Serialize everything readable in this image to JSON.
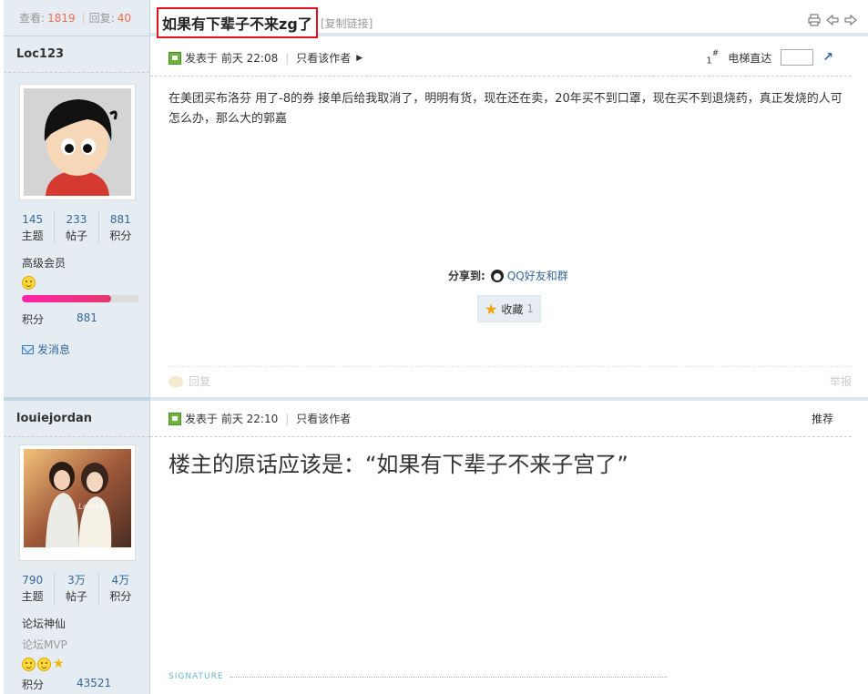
{
  "thread": {
    "views_label": "查看:",
    "views": "1819",
    "replies_label": "回复:",
    "replies": "40",
    "title": "如果有下辈子不来zg了",
    "copy_link": "[复制链接]"
  },
  "posts": [
    {
      "author": "Loc123",
      "stats": [
        {
          "value": "145",
          "label": "主题"
        },
        {
          "value": "233",
          "label": "帖子"
        },
        {
          "value": "881",
          "label": "积分"
        }
      ],
      "rank": "高级会员",
      "level_progress": 0.76,
      "score_label": "积分",
      "score": "881",
      "send_msg": "发消息",
      "posted": "发表于 前天 22:08",
      "only_author": "只看该作者",
      "floor": "1",
      "floor_mark": "#",
      "jump_label": "电梯直达",
      "content": "在美团买布洛芬 用了-8的券 接单后给我取消了，明明有货，现在还在卖，20年买不到口罩，现在买不到退烧药，真正发烧的人可怎么办，那么大的郭嘉",
      "share_label": "分享到:",
      "share_qq": "QQ好友和群",
      "fav_label": "收藏",
      "fav_count": "1",
      "reply": "回复",
      "report": "举报"
    },
    {
      "author": "louiejordan",
      "stats": [
        {
          "value": "790",
          "label": "主题"
        },
        {
          "value": "3万",
          "label": "帖子"
        },
        {
          "value": "4万",
          "label": "积分"
        }
      ],
      "rank": "论坛神仙",
      "rank2": "论坛MVP",
      "score_label": "积分",
      "score": "43521",
      "posted": "发表于 前天 22:10",
      "only_author": "只看该作者",
      "recommend": "推荐",
      "content": "楼主的原话应该是：“如果有下辈子不来子宫了”",
      "signature": "SIGNATURE"
    }
  ],
  "colors": {
    "side_bg": "#e5edf2",
    "accent": "#336699",
    "highlight_border": "#e0141e"
  }
}
